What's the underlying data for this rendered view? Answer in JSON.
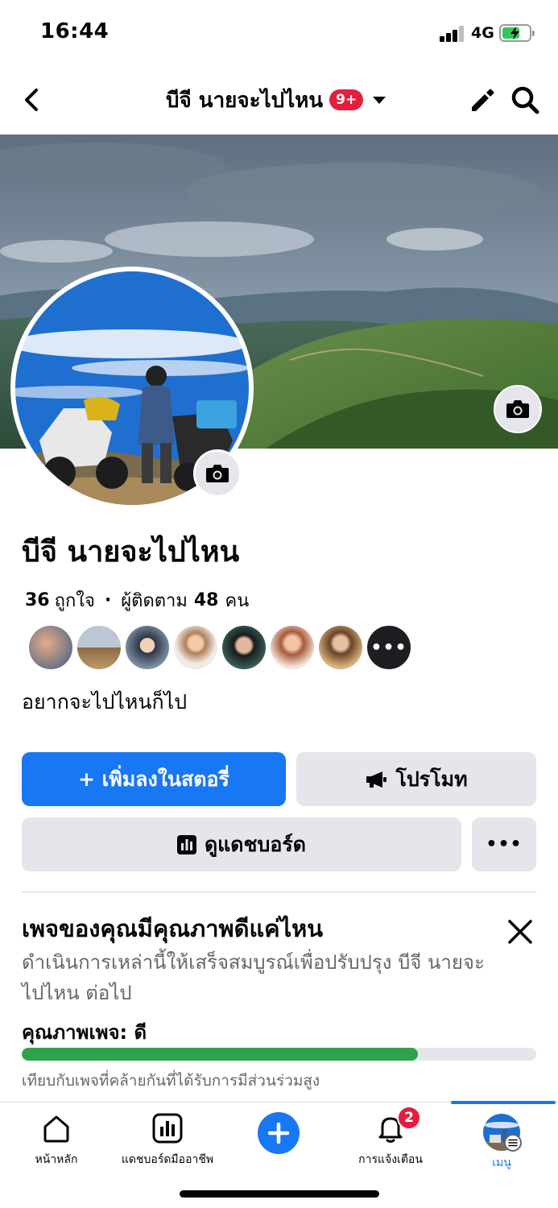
{
  "status_bar": {
    "time": "16:44",
    "network": "4G",
    "battery_level": 0.65,
    "charging": true
  },
  "header": {
    "back_icon": "chevron-left-icon",
    "title": "บีจี นายจะไปไหน",
    "badge": "9+",
    "edit_icon": "pencil-icon",
    "search_icon": "search-icon"
  },
  "profile": {
    "name": "บีจี นายจะไปไหน",
    "likes_count": "36",
    "likes_label": "ถูกใจ",
    "followers_label": "ผู้ติดตาม",
    "followers_count": "48",
    "followers_unit": "คน",
    "bio": "อยากจะไปไหนก็ไป",
    "more_friends": "•••"
  },
  "actions": {
    "add_story": "+ เพิ่มลงในสตอรี่",
    "promote": "โปรโมท",
    "dashboard": "ดูแดชบอร์ด",
    "more": "•••"
  },
  "quality_card": {
    "title": "เพจของคุณมีคุณภาพดีแค่ไหน",
    "description": "ดำเนินการเหล่านี้ให้เสร็จสมบูรณ์เพื่อปรับปรุง บีจี นายจะไปไหน ต่อไป",
    "label": "คุณภาพเพจ:  ดี",
    "progress": 0.77,
    "note": "เทียบกับเพจที่คล้ายกันที่ได้รับการมีส่วนร่วมสูง"
  },
  "bottom_nav": {
    "home": "หน้าหลัก",
    "dashboard": "แดชบอร์ดมืออาชีพ",
    "notifications": "การแจ้งเตือน",
    "notifications_badge": "2",
    "menu": "เมนู"
  },
  "colors": {
    "accent": "#1877f2",
    "badge": "#e41e3f",
    "quality_bar": "#31a24c"
  }
}
